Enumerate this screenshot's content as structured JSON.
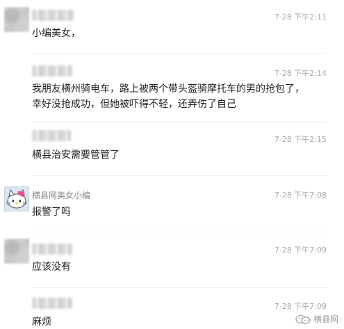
{
  "comments": [
    {
      "name": "",
      "time": "7-28 下午2:11",
      "text": "小编美女，"
    },
    {
      "name": "",
      "time": "7-28 下午2:14",
      "text": "我朋友横州骑电车，路上被两个带头盔骑摩托车的男的抢包了，\n幸好没抢成功，但她被吓得不轻，还弄伤了自己"
    },
    {
      "name": "",
      "time": "7-28 下午2:15",
      "text": "横县治安需要管管了"
    },
    {
      "name": "横县网美女小编",
      "time": "7-28 下午7:08",
      "text": "报警了吗"
    },
    {
      "name": "",
      "time": "7-28 下午7:09",
      "text": "应该没有"
    },
    {
      "name": "",
      "time": "7-28 下午7:09",
      "text": "麻烦"
    }
  ],
  "watermark": {
    "label": "横县网",
    "icon": "wechat-channel-icon"
  }
}
